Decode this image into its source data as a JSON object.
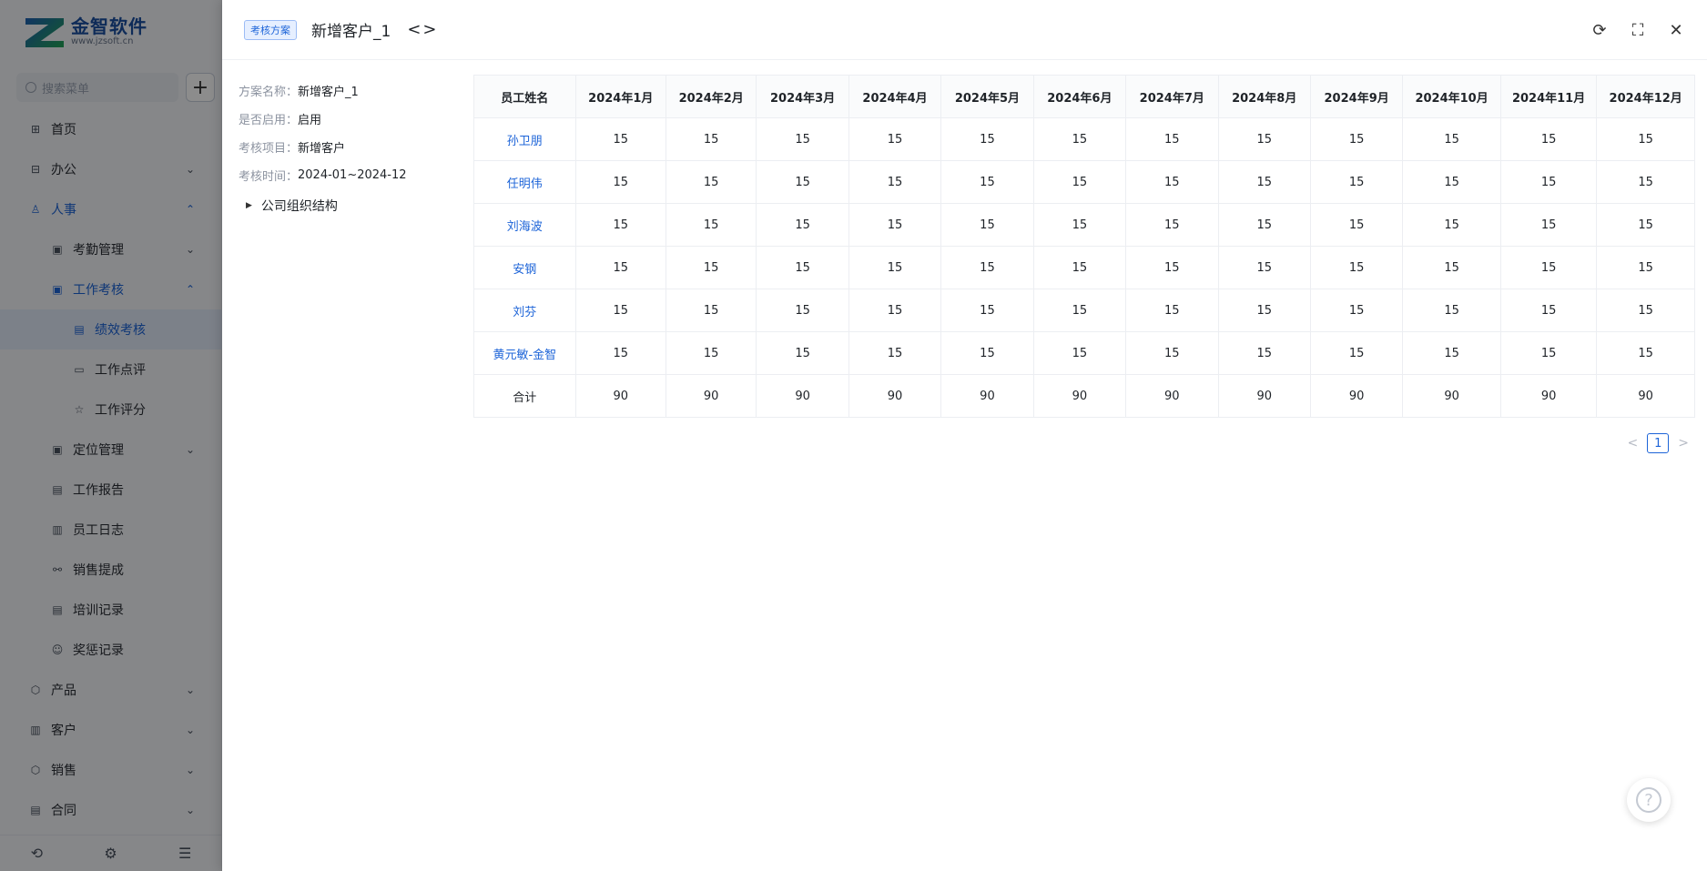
{
  "app": {
    "logo_name": "金智软件",
    "logo_url": "www.jzsoft.cn",
    "search_placeholder": "搜索菜单",
    "add_symbol": "+"
  },
  "menu": [
    {
      "label": "首页",
      "icon": "home-icon",
      "level": 1
    },
    {
      "label": "办公",
      "icon": "office-icon",
      "level": 1,
      "expandable": true,
      "expanded": false
    },
    {
      "label": "人事",
      "icon": "hr-icon",
      "level": 1,
      "expandable": true,
      "expanded": true,
      "highlight": true
    },
    {
      "label": "考勤管理",
      "icon": "attendance-icon",
      "level": 2,
      "expandable": true,
      "expanded": false
    },
    {
      "label": "工作考核",
      "icon": "assessment-icon",
      "level": 2,
      "expandable": true,
      "expanded": true,
      "highlight": true
    },
    {
      "label": "绩效考核",
      "icon": "performance-icon",
      "level": 3,
      "active": true
    },
    {
      "label": "工作点评",
      "icon": "comment-icon",
      "level": 3
    },
    {
      "label": "工作评分",
      "icon": "star-icon",
      "level": 3
    },
    {
      "label": "定位管理",
      "icon": "location-icon",
      "level": 2,
      "expandable": true,
      "expanded": false
    },
    {
      "label": "工作报告",
      "icon": "report-icon",
      "level": 2
    },
    {
      "label": "员工日志",
      "icon": "log-icon",
      "level": 2
    },
    {
      "label": "销售提成",
      "icon": "commission-icon",
      "level": 2
    },
    {
      "label": "培训记录",
      "icon": "training-icon",
      "level": 2
    },
    {
      "label": "奖惩记录",
      "icon": "reward-icon",
      "level": 2
    },
    {
      "label": "产品",
      "icon": "product-icon",
      "level": 1,
      "expandable": true,
      "expanded": false
    },
    {
      "label": "客户",
      "icon": "customer-icon",
      "level": 1,
      "expandable": true,
      "expanded": false
    },
    {
      "label": "销售",
      "icon": "sales-icon",
      "level": 1,
      "expandable": true,
      "expanded": false
    },
    {
      "label": "合同",
      "icon": "contract-icon",
      "level": 1,
      "expandable": true,
      "expanded": false
    }
  ],
  "drawer": {
    "tag": "考核方案",
    "title": "新增客户_1",
    "nav_arrows": "<>",
    "info": [
      {
        "label": "方案名称：",
        "value": "新增客户_1"
      },
      {
        "label": "是否启用：",
        "value": "启用"
      },
      {
        "label": "考核项目：",
        "value": "新增客户"
      },
      {
        "label": "考核时间：",
        "value": "2024-01~2024-12"
      }
    ],
    "tree_root": "公司组织结构"
  },
  "table": {
    "headers": [
      "员工姓名",
      "2024年1月",
      "2024年2月",
      "2024年3月",
      "2024年4月",
      "2024年5月",
      "2024年6月",
      "2024年7月",
      "2024年8月",
      "2024年9月",
      "2024年10月",
      "2024年11月",
      "2024年12月"
    ],
    "rows": [
      {
        "name": "孙卫朋",
        "values": [
          "15",
          "15",
          "15",
          "15",
          "15",
          "15",
          "15",
          "15",
          "15",
          "15",
          "15",
          "15"
        ]
      },
      {
        "name": "任明伟",
        "values": [
          "15",
          "15",
          "15",
          "15",
          "15",
          "15",
          "15",
          "15",
          "15",
          "15",
          "15",
          "15"
        ]
      },
      {
        "name": "刘海波",
        "values": [
          "15",
          "15",
          "15",
          "15",
          "15",
          "15",
          "15",
          "15",
          "15",
          "15",
          "15",
          "15"
        ]
      },
      {
        "name": "安钢",
        "values": [
          "15",
          "15",
          "15",
          "15",
          "15",
          "15",
          "15",
          "15",
          "15",
          "15",
          "15",
          "15"
        ]
      },
      {
        "name": "刘芬",
        "values": [
          "15",
          "15",
          "15",
          "15",
          "15",
          "15",
          "15",
          "15",
          "15",
          "15",
          "15",
          "15"
        ]
      },
      {
        "name": "黄元敏-金智",
        "values": [
          "15",
          "15",
          "15",
          "15",
          "15",
          "15",
          "15",
          "15",
          "15",
          "15",
          "15",
          "15"
        ]
      }
    ],
    "total": {
      "name": "合计",
      "values": [
        "90",
        "90",
        "90",
        "90",
        "90",
        "90",
        "90",
        "90",
        "90",
        "90",
        "90",
        "90"
      ]
    }
  },
  "pager": {
    "prev": "<",
    "current": "1",
    "next": ">"
  },
  "help_symbol": "?"
}
